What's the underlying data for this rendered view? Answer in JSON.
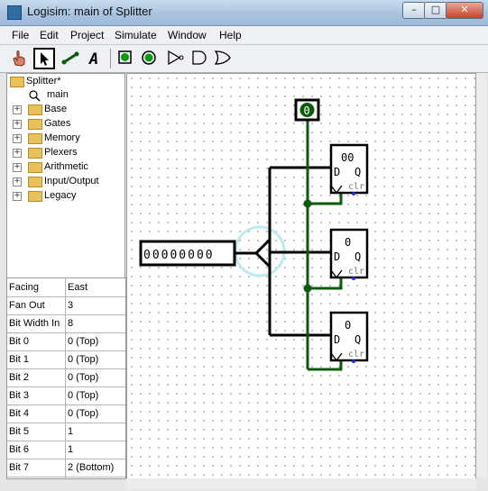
{
  "window": {
    "title": "Logisim: main of Splitter",
    "min_label": "–",
    "max_label": "□",
    "close_label": "✕"
  },
  "menubar": {
    "items": [
      "File",
      "Edit",
      "Project",
      "Simulate",
      "Window",
      "Help"
    ]
  },
  "toolbar": {
    "tools": [
      "poke-tool-icon",
      "select-tool-icon",
      "wire-tool-icon",
      "text-tool-icon",
      "input-pin-icon",
      "output-pin-icon",
      "not-gate-icon",
      "and-gate-icon",
      "or-gate-icon"
    ],
    "selected": "select-tool-icon"
  },
  "explorer": {
    "project": "Splitter*",
    "circuit": "main",
    "libraries": [
      "Base",
      "Gates",
      "Memory",
      "Plexers",
      "Arithmetic",
      "Input/Output",
      "Legacy"
    ]
  },
  "attributes": [
    {
      "key": "Facing",
      "value": "East"
    },
    {
      "key": "Fan Out",
      "value": "3"
    },
    {
      "key": "Bit Width In",
      "value": "8"
    },
    {
      "key": "Bit 0",
      "value": "0 (Top)"
    },
    {
      "key": "Bit 1",
      "value": "0 (Top)"
    },
    {
      "key": "Bit 2",
      "value": "0 (Top)"
    },
    {
      "key": "Bit 3",
      "value": "0 (Top)"
    },
    {
      "key": "Bit 4",
      "value": "0 (Top)"
    },
    {
      "key": "Bit 5",
      "value": "1"
    },
    {
      "key": "Bit 6",
      "value": "1"
    },
    {
      "key": "Bit 7",
      "value": "2 (Bottom)"
    }
  ],
  "circuit": {
    "input_pin_value": "00000000",
    "clock_value": "0",
    "registers": [
      {
        "value": "00",
        "d_label": "D",
        "q_label": "Q",
        "clr_label": "clr"
      },
      {
        "value": "0",
        "d_label": "D",
        "q_label": "Q",
        "clr_label": "clr"
      },
      {
        "value": "0",
        "d_label": "D",
        "q_label": "Q",
        "clr_label": "clr"
      }
    ],
    "colors": {
      "active_wire": "#0c5a0c",
      "bus_wire": "#000000",
      "selection": "#bde8f5",
      "pin_dot": "#2a2ae0"
    }
  }
}
